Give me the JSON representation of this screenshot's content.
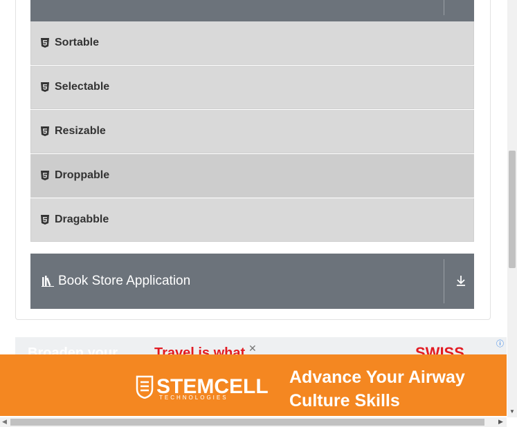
{
  "menu": {
    "items": [
      {
        "label": "Sortable",
        "icon": "html5-icon"
      },
      {
        "label": "Selectable",
        "icon": "html5-icon"
      },
      {
        "label": "Resizable",
        "icon": "html5-icon"
      },
      {
        "label": "Droppable",
        "icon": "html5-icon",
        "active": true
      },
      {
        "label": "Dragabble",
        "icon": "html5-icon"
      }
    ]
  },
  "book_store": {
    "title": "Book Store Application",
    "icon": "books-icon",
    "toggle_icon": "download-arrow-icon"
  },
  "ads": {
    "top_left": "Broaden your",
    "top_middle": "Travel is what",
    "top_right_brand": "SWISS",
    "info": "ⓘ",
    "close": "✕",
    "brand": "STEMCELL",
    "brand_tagline": "TECHNOLOGIES",
    "headline_line1": "Advance Your Airway",
    "headline_line2": "Culture Skills"
  },
  "colors": {
    "header_bg": "#6c737b",
    "item_bg": "#d9d9d9",
    "ad_orange": "#f48721",
    "swiss_red": "#e21b23"
  }
}
